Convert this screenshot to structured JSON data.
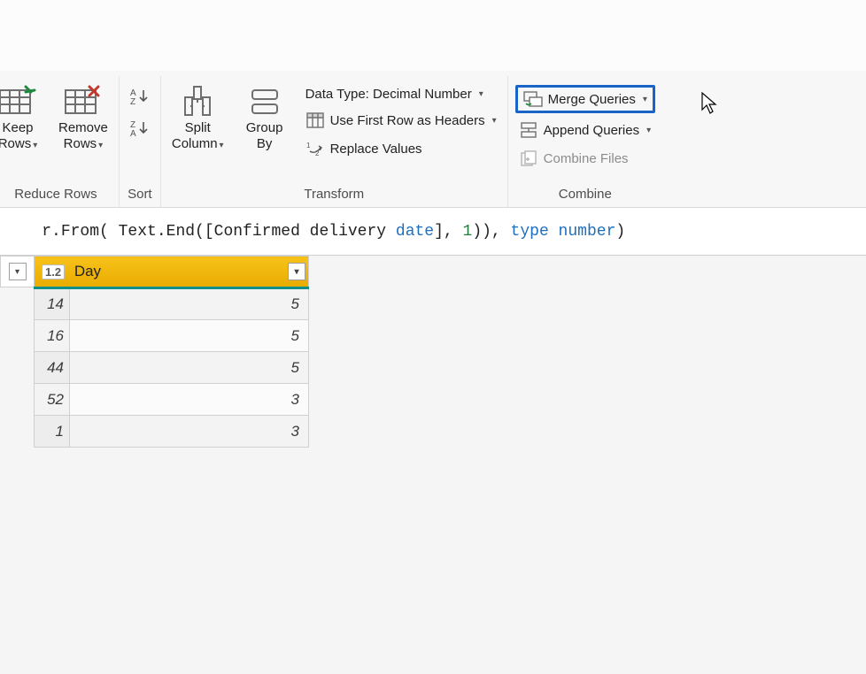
{
  "ribbon": {
    "reduce_rows": {
      "keep_rows": "Keep\nRows",
      "remove_rows": "Remove\nRows",
      "group_label": "Reduce Rows"
    },
    "sort": {
      "group_label": "Sort"
    },
    "transform": {
      "split_column": "Split\nColumn",
      "group_by": "Group\nBy",
      "data_type_label": "Data Type: Decimal Number",
      "first_row_headers": "Use First Row as Headers",
      "replace_values": "Replace Values",
      "group_label": "Transform"
    },
    "combine": {
      "merge_queries": "Merge Queries",
      "append_queries": "Append Queries",
      "combine_files": "Combine Files",
      "group_label": "Combine"
    }
  },
  "formula": {
    "p1": "r.From( Text.End([Confirmed delivery ",
    "p2": "date",
    "p3": "], ",
    "p4": "1",
    "p5": ")), ",
    "p6": "type number",
    "p7": ")"
  },
  "grid": {
    "column": {
      "type_badge": "1.2",
      "name": "Day"
    },
    "rows": [
      {
        "idx": "14",
        "val": "5"
      },
      {
        "idx": "16",
        "val": "5"
      },
      {
        "idx": "44",
        "val": "5"
      },
      {
        "idx": "52",
        "val": "3"
      },
      {
        "idx": "1",
        "val": "3"
      }
    ]
  }
}
